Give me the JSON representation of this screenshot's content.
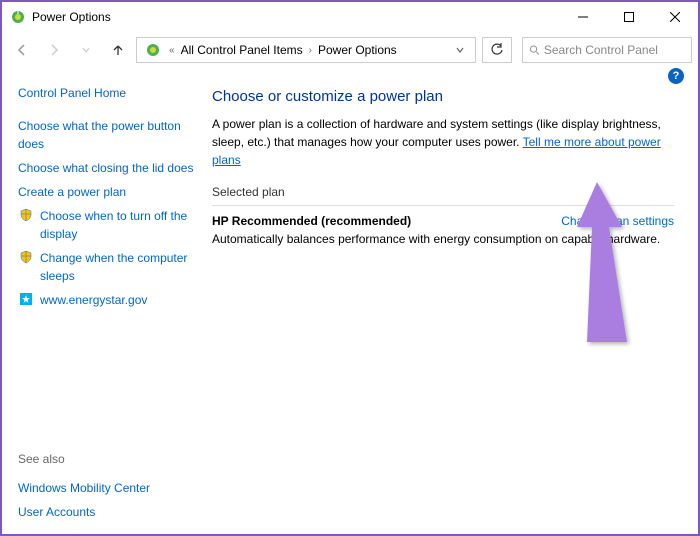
{
  "window": {
    "title": "Power Options"
  },
  "breadcrumb": {
    "level1": "All Control Panel Items",
    "level2": "Power Options"
  },
  "search": {
    "placeholder": "Search Control Panel"
  },
  "sidebar": {
    "home": "Control Panel Home",
    "links": {
      "power_button": "Choose what the power button does",
      "lid": "Choose what closing the lid does",
      "create_plan": "Create a power plan",
      "turn_off_display": "Choose when to turn off the display",
      "sleeps": "Change when the computer sleeps",
      "energystar": "www.energystar.gov"
    },
    "see_also": "See also",
    "see_also_links": {
      "mobility": "Windows Mobility Center",
      "accounts": "User Accounts"
    }
  },
  "main": {
    "heading": "Choose or customize a power plan",
    "desc_prefix": "A power plan is a collection of hardware and system settings (like display brightness, sleep, etc.) that manages how your computer uses power. ",
    "desc_link": "Tell me more about power plans",
    "section": "Selected plan",
    "plan_name": "HP Recommended (recommended)",
    "change_link": "Change plan settings",
    "plan_desc": "Automatically balances performance with energy consumption on capable hardware."
  },
  "help": "?"
}
